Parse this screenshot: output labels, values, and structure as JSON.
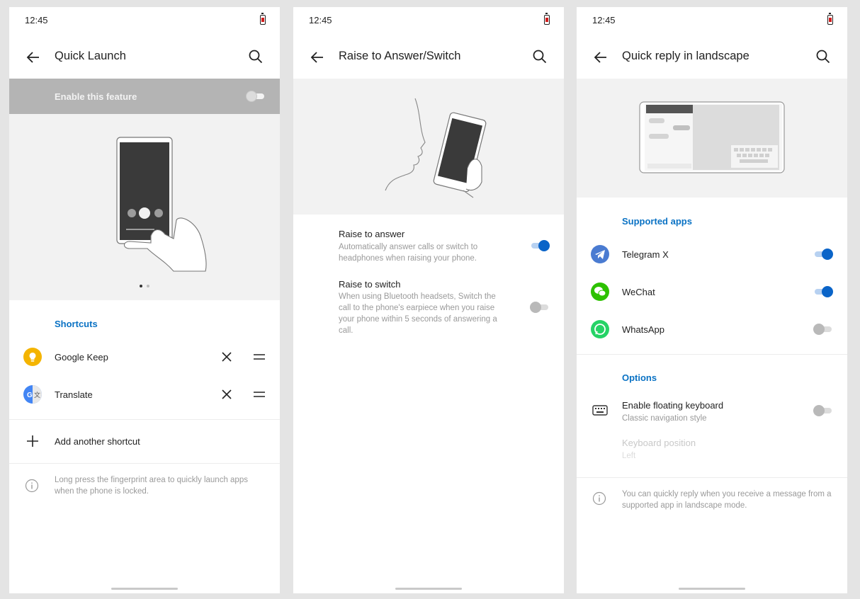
{
  "status": {
    "time": "12:45"
  },
  "quick_launch": {
    "title": "Quick Launch",
    "enable_label": "Enable this feature",
    "enable_on": false,
    "shortcuts_header": "Shortcuts",
    "shortcuts": [
      {
        "label": "Google Keep",
        "icon": "google-keep-icon",
        "color": "#f4b400"
      },
      {
        "label": "Translate",
        "icon": "translate-icon",
        "color": "#4285f4"
      }
    ],
    "add_label": "Add another shortcut",
    "info": "Long press the fingerprint area to quickly launch apps when the phone is locked.",
    "pager_current": 1,
    "pager_total": 2
  },
  "raise": {
    "title": "Raise to Answer/Switch",
    "items": [
      {
        "label": "Raise to answer",
        "sub": "Automatically answer calls or switch to headphones when raising your phone.",
        "on": true
      },
      {
        "label": "Raise to switch",
        "sub": "When using Bluetooth headsets, Switch the call to the phone's earpiece when you raise your phone within 5 seconds of answering a call.",
        "on": false
      }
    ]
  },
  "quick_reply": {
    "title": "Quick reply in landscape",
    "supported_header": "Supported apps",
    "apps": [
      {
        "label": "Telegram X",
        "icon": "telegram-icon",
        "color": "#4a7bd1",
        "on": true
      },
      {
        "label": "WeChat",
        "icon": "wechat-icon",
        "color": "#2dc100",
        "on": true
      },
      {
        "label": "WhatsApp",
        "icon": "whatsapp-icon",
        "color": "#25d366",
        "on": false
      }
    ],
    "options_header": "Options",
    "floating_keyboard": {
      "label": "Enable floating keyboard",
      "sub": "Classic navigation style",
      "on": false
    },
    "keyboard_position": {
      "label": "Keyboard position",
      "sub": "Left"
    },
    "info": "You can quickly reply when you receive a message from a supported app in landscape mode."
  },
  "colors": {
    "accent": "#0a64c8",
    "header": "#0a72c4",
    "enable_bar": "#b4b4b4"
  }
}
